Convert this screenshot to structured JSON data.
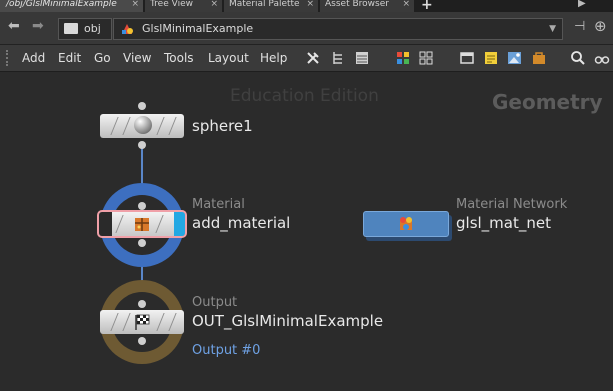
{
  "tabs": [
    {
      "label": "/obj/GlslMinimalExample",
      "active": true
    },
    {
      "label": "Tree View"
    },
    {
      "label": "Material Palette"
    },
    {
      "label": "Asset Browser"
    }
  ],
  "tab_close_glyph": "×",
  "tab_add_glyph": "+",
  "path": {
    "segments": [
      {
        "label": "obj"
      },
      {
        "label": "GlslMinimalExample"
      }
    ]
  },
  "menu": [
    "Add",
    "Edit",
    "Go",
    "View",
    "Tools",
    "Layout",
    "Help"
  ],
  "watermark": "Education Edition",
  "context_label": "Geometry",
  "nodes": {
    "sphere": {
      "name": "sphere1",
      "type": "",
      "icon": "sphere-icon"
    },
    "material": {
      "name": "add_material",
      "type": "Material",
      "icon": "material-box-icon"
    },
    "output": {
      "name": "OUT_GlslMinimalExample",
      "type": "Output",
      "output_index": "Output #0",
      "icon": "checkered-flag-icon"
    },
    "matnet": {
      "name": "glsl_mat_net",
      "type": "Material Network",
      "icon": "material-network-icon"
    }
  },
  "colors": {
    "material_ring": "#3d6fc0",
    "output_ring": "#6e5a33",
    "wire": "#5a86c8",
    "matnet_node": "#4f84be",
    "selection": "#f0a0a8"
  }
}
